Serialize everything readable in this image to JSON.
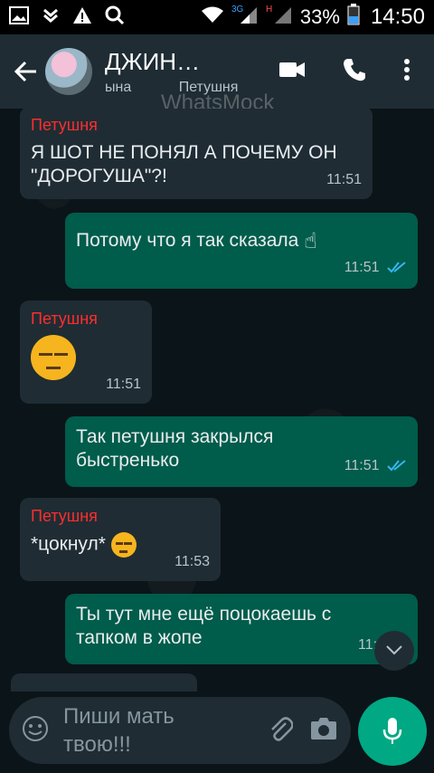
{
  "status": {
    "battery": "33%",
    "time": "14:50",
    "network_badges": [
      "3G",
      "H"
    ]
  },
  "header": {
    "title": "ДЖИН…",
    "subtitle_parts": [
      "ына",
      "Петушня"
    ],
    "watermark": "WhatsMock"
  },
  "messages": [
    {
      "type": "in",
      "sender": "Петушня",
      "text": "Я ШОТ НЕ ПОНЯЛ А ПОЧЕМУ ОН \"ДОРОГУША\"?!",
      "time": "11:51"
    },
    {
      "type": "out",
      "text": "Потому что я так сказала",
      "time": "11:51"
    },
    {
      "type": "in",
      "sender": "Петушня",
      "text": "",
      "time": "11:51"
    },
    {
      "type": "out",
      "text": "Так петушня закрылся быстренько",
      "time": "11:51"
    },
    {
      "type": "in",
      "sender": "Петушня",
      "text": "*цокнул*",
      "time": "11:53"
    },
    {
      "type": "out",
      "text": "Ты тут мне ещё поцокаешь с тапком в жопе",
      "time": "11:5"
    }
  ],
  "composer": {
    "placeholder": "Пиши мать твою!!!"
  },
  "colors": {
    "accent": "#00a884",
    "incoming": "#1f2c34",
    "outgoing": "#005c4b",
    "sender": "#ff2d2d"
  }
}
